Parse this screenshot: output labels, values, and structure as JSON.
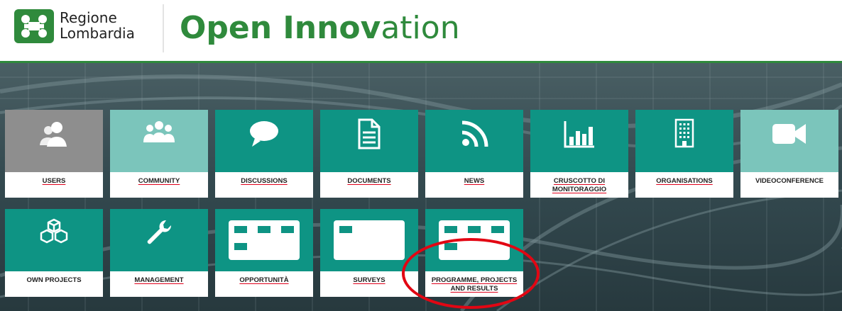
{
  "header": {
    "logo_line1": "Regione",
    "logo_line2": "Lombardia",
    "title_bold": "Open Innov",
    "title_light": "ation"
  },
  "colors": {
    "brand_green": "#2f8a3c",
    "tile_teal": "#0e9484",
    "tile_light": "#7bc5bb",
    "tile_grey": "#8e8e8e",
    "highlight_red": "#e20613"
  },
  "tiles": [
    {
      "label": "USERS",
      "icon": "users-icon"
    },
    {
      "label": "COMMUNITY",
      "icon": "community-icon"
    },
    {
      "label": "DISCUSSIONS",
      "icon": "speech-bubble-icon"
    },
    {
      "label": "DOCUMENTS",
      "icon": "document-icon"
    },
    {
      "label": "NEWS",
      "icon": "rss-icon"
    },
    {
      "label": "CRUSCOTTO DI MONITORAGGIO",
      "icon": "bar-chart-icon"
    },
    {
      "label": "ORGANISATIONS",
      "icon": "building-icon"
    },
    {
      "label": "VIDEOCONFERENCE",
      "icon": "video-camera-icon"
    },
    {
      "label": "OWN PROJECTS",
      "icon": "cubes-icon"
    },
    {
      "label": "MANAGEMENT",
      "icon": "wrench-icon"
    },
    {
      "label": "OPPORTUNITÀ",
      "icon": "grid-icon"
    },
    {
      "label": "SURVEYS",
      "icon": "panel-icon"
    },
    {
      "label": "PROGRAMME, PROJECTS AND RESULTS",
      "icon": "grid-icon"
    }
  ]
}
